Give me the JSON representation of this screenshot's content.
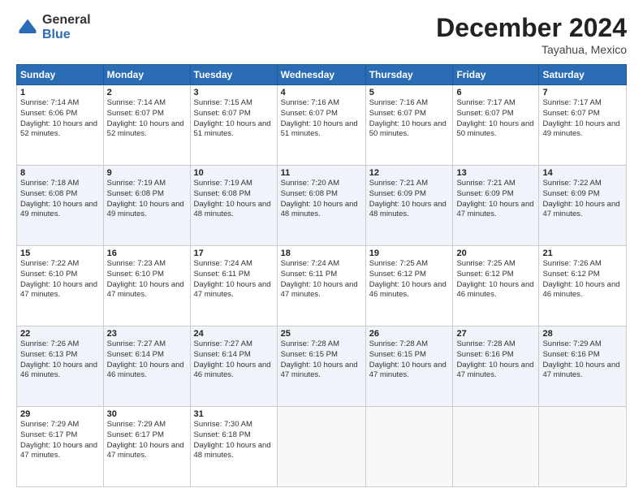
{
  "logo": {
    "general": "General",
    "blue": "Blue"
  },
  "header": {
    "title": "December 2024",
    "location": "Tayahua, Mexico"
  },
  "days": [
    "Sunday",
    "Monday",
    "Tuesday",
    "Wednesday",
    "Thursday",
    "Friday",
    "Saturday"
  ],
  "weeks": [
    [
      {
        "day": "1",
        "sunrise": "Sunrise: 7:14 AM",
        "sunset": "Sunset: 6:06 PM",
        "daylight": "Daylight: 10 hours and 52 minutes."
      },
      {
        "day": "2",
        "sunrise": "Sunrise: 7:14 AM",
        "sunset": "Sunset: 6:07 PM",
        "daylight": "Daylight: 10 hours and 52 minutes."
      },
      {
        "day": "3",
        "sunrise": "Sunrise: 7:15 AM",
        "sunset": "Sunset: 6:07 PM",
        "daylight": "Daylight: 10 hours and 51 minutes."
      },
      {
        "day": "4",
        "sunrise": "Sunrise: 7:16 AM",
        "sunset": "Sunset: 6:07 PM",
        "daylight": "Daylight: 10 hours and 51 minutes."
      },
      {
        "day": "5",
        "sunrise": "Sunrise: 7:16 AM",
        "sunset": "Sunset: 6:07 PM",
        "daylight": "Daylight: 10 hours and 50 minutes."
      },
      {
        "day": "6",
        "sunrise": "Sunrise: 7:17 AM",
        "sunset": "Sunset: 6:07 PM",
        "daylight": "Daylight: 10 hours and 50 minutes."
      },
      {
        "day": "7",
        "sunrise": "Sunrise: 7:17 AM",
        "sunset": "Sunset: 6:07 PM",
        "daylight": "Daylight: 10 hours and 49 minutes."
      }
    ],
    [
      {
        "day": "8",
        "sunrise": "Sunrise: 7:18 AM",
        "sunset": "Sunset: 6:08 PM",
        "daylight": "Daylight: 10 hours and 49 minutes."
      },
      {
        "day": "9",
        "sunrise": "Sunrise: 7:19 AM",
        "sunset": "Sunset: 6:08 PM",
        "daylight": "Daylight: 10 hours and 49 minutes."
      },
      {
        "day": "10",
        "sunrise": "Sunrise: 7:19 AM",
        "sunset": "Sunset: 6:08 PM",
        "daylight": "Daylight: 10 hours and 48 minutes."
      },
      {
        "day": "11",
        "sunrise": "Sunrise: 7:20 AM",
        "sunset": "Sunset: 6:08 PM",
        "daylight": "Daylight: 10 hours and 48 minutes."
      },
      {
        "day": "12",
        "sunrise": "Sunrise: 7:21 AM",
        "sunset": "Sunset: 6:09 PM",
        "daylight": "Daylight: 10 hours and 48 minutes."
      },
      {
        "day": "13",
        "sunrise": "Sunrise: 7:21 AM",
        "sunset": "Sunset: 6:09 PM",
        "daylight": "Daylight: 10 hours and 47 minutes."
      },
      {
        "day": "14",
        "sunrise": "Sunrise: 7:22 AM",
        "sunset": "Sunset: 6:09 PM",
        "daylight": "Daylight: 10 hours and 47 minutes."
      }
    ],
    [
      {
        "day": "15",
        "sunrise": "Sunrise: 7:22 AM",
        "sunset": "Sunset: 6:10 PM",
        "daylight": "Daylight: 10 hours and 47 minutes."
      },
      {
        "day": "16",
        "sunrise": "Sunrise: 7:23 AM",
        "sunset": "Sunset: 6:10 PM",
        "daylight": "Daylight: 10 hours and 47 minutes."
      },
      {
        "day": "17",
        "sunrise": "Sunrise: 7:24 AM",
        "sunset": "Sunset: 6:11 PM",
        "daylight": "Daylight: 10 hours and 47 minutes."
      },
      {
        "day": "18",
        "sunrise": "Sunrise: 7:24 AM",
        "sunset": "Sunset: 6:11 PM",
        "daylight": "Daylight: 10 hours and 47 minutes."
      },
      {
        "day": "19",
        "sunrise": "Sunrise: 7:25 AM",
        "sunset": "Sunset: 6:12 PM",
        "daylight": "Daylight: 10 hours and 46 minutes."
      },
      {
        "day": "20",
        "sunrise": "Sunrise: 7:25 AM",
        "sunset": "Sunset: 6:12 PM",
        "daylight": "Daylight: 10 hours and 46 minutes."
      },
      {
        "day": "21",
        "sunrise": "Sunrise: 7:26 AM",
        "sunset": "Sunset: 6:12 PM",
        "daylight": "Daylight: 10 hours and 46 minutes."
      }
    ],
    [
      {
        "day": "22",
        "sunrise": "Sunrise: 7:26 AM",
        "sunset": "Sunset: 6:13 PM",
        "daylight": "Daylight: 10 hours and 46 minutes."
      },
      {
        "day": "23",
        "sunrise": "Sunrise: 7:27 AM",
        "sunset": "Sunset: 6:14 PM",
        "daylight": "Daylight: 10 hours and 46 minutes."
      },
      {
        "day": "24",
        "sunrise": "Sunrise: 7:27 AM",
        "sunset": "Sunset: 6:14 PM",
        "daylight": "Daylight: 10 hours and 46 minutes."
      },
      {
        "day": "25",
        "sunrise": "Sunrise: 7:28 AM",
        "sunset": "Sunset: 6:15 PM",
        "daylight": "Daylight: 10 hours and 47 minutes."
      },
      {
        "day": "26",
        "sunrise": "Sunrise: 7:28 AM",
        "sunset": "Sunset: 6:15 PM",
        "daylight": "Daylight: 10 hours and 47 minutes."
      },
      {
        "day": "27",
        "sunrise": "Sunrise: 7:28 AM",
        "sunset": "Sunset: 6:16 PM",
        "daylight": "Daylight: 10 hours and 47 minutes."
      },
      {
        "day": "28",
        "sunrise": "Sunrise: 7:29 AM",
        "sunset": "Sunset: 6:16 PM",
        "daylight": "Daylight: 10 hours and 47 minutes."
      }
    ],
    [
      {
        "day": "29",
        "sunrise": "Sunrise: 7:29 AM",
        "sunset": "Sunset: 6:17 PM",
        "daylight": "Daylight: 10 hours and 47 minutes."
      },
      {
        "day": "30",
        "sunrise": "Sunrise: 7:29 AM",
        "sunset": "Sunset: 6:17 PM",
        "daylight": "Daylight: 10 hours and 47 minutes."
      },
      {
        "day": "31",
        "sunrise": "Sunrise: 7:30 AM",
        "sunset": "Sunset: 6:18 PM",
        "daylight": "Daylight: 10 hours and 48 minutes."
      },
      null,
      null,
      null,
      null
    ]
  ]
}
